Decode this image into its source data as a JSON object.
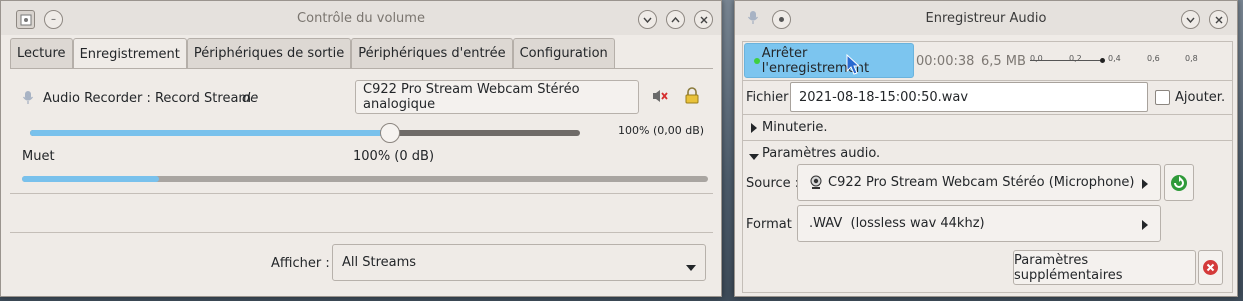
{
  "volume_window": {
    "title": "Contrôle du volume",
    "tabs": [
      "Lecture",
      "Enregistrement",
      "Périphériques de sortie",
      "Périphériques d'entrée",
      "Configuration"
    ],
    "active_tab": "Enregistrement",
    "stream": {
      "name": "Audio Recorder : Record Stream",
      "de": "de",
      "device": "C922 Pro Stream Webcam Stéréo analogique",
      "level_text": "100% (0,00 dB)",
      "level": 0.65
    },
    "muet_label": "Muet",
    "muet_value": "100% (0 dB)",
    "meter_level": 0.2,
    "afficher_label": "Afficher :",
    "afficher_value": "All Streams"
  },
  "recorder_window": {
    "title": "Enregistreur Audio",
    "stop_button": "Arrêter l'enregistrement",
    "elapsed": "00:00:38",
    "size": "6,5 MB",
    "scale": [
      "0,0",
      "0,2",
      "0,4",
      "0,6",
      "0,8"
    ],
    "fichier_label": "Fichier :",
    "fichier_value": "2021-08-18-15:00:50.wav",
    "ajouter_label": "Ajouter.",
    "minuterie_label": "Minuterie.",
    "params_label": "Paramètres audio.",
    "source_label": "Source :",
    "source_value": "C922 Pro Stream Webcam Stéréo (Microphone)",
    "format_label": "Format :",
    "format_value": ".WAV  (lossless wav 44khz)",
    "more_button": "Paramètres supplémentaires"
  },
  "colors": {
    "accent": "#79c1ec",
    "window_bg": "#efebe7",
    "close_red": "#d43a3a",
    "refresh_green": "#2f9a3a"
  },
  "icons": [
    "app-icon",
    "minimize-icon",
    "maximize-icon",
    "close-icon",
    "microphone-icon",
    "mute-speaker-icon",
    "lock-icon",
    "webcam-icon",
    "refresh-icon",
    "cancel-icon",
    "cursor-icon"
  ]
}
